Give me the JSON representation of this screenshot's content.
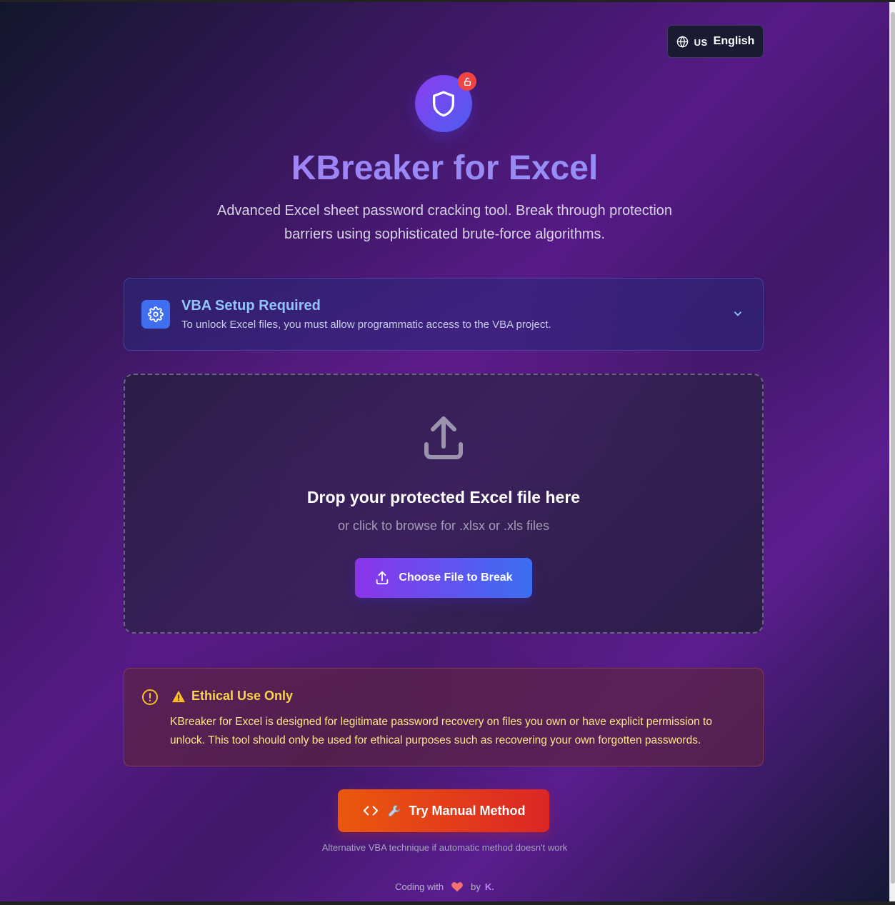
{
  "language": {
    "flag": "US",
    "label": "English",
    "icon": "globe-icon"
  },
  "hero": {
    "title": "KBreaker for Excel",
    "subtitle": "Advanced Excel sheet password cracking tool. Break through protection barriers using sophisticated brute-force algorithms.",
    "logo_icon": "shield-icon",
    "badge_icon": "unlock-icon"
  },
  "vba_setup": {
    "title": "VBA Setup Required",
    "description": "To unlock Excel files, you must allow programmatic access to the VBA project.",
    "icon": "gear-icon"
  },
  "upload": {
    "title": "Drop your protected Excel file here",
    "subtitle": "or click to browse for .xlsx or .xls files",
    "button_label": "Choose File to Break"
  },
  "ethics": {
    "title": "Ethical Use Only",
    "text": "KBreaker for Excel is designed for legitimate password recovery on files you own or have explicit permission to unlock. This tool should only be used for ethical purposes such as recovering your own forgotten passwords."
  },
  "manual": {
    "button_label": "Try Manual Method",
    "hint": "Alternative VBA technique if automatic method doesn't work"
  },
  "footer": {
    "prefix": "Coding with",
    "by": "by",
    "author": "K."
  },
  "colors": {
    "accent_purple": "#8b34ea",
    "accent_blue": "#3b6ff2",
    "warning": "#fcd34d",
    "danger": "#ef4444",
    "manual_orange": "#ea580c"
  }
}
